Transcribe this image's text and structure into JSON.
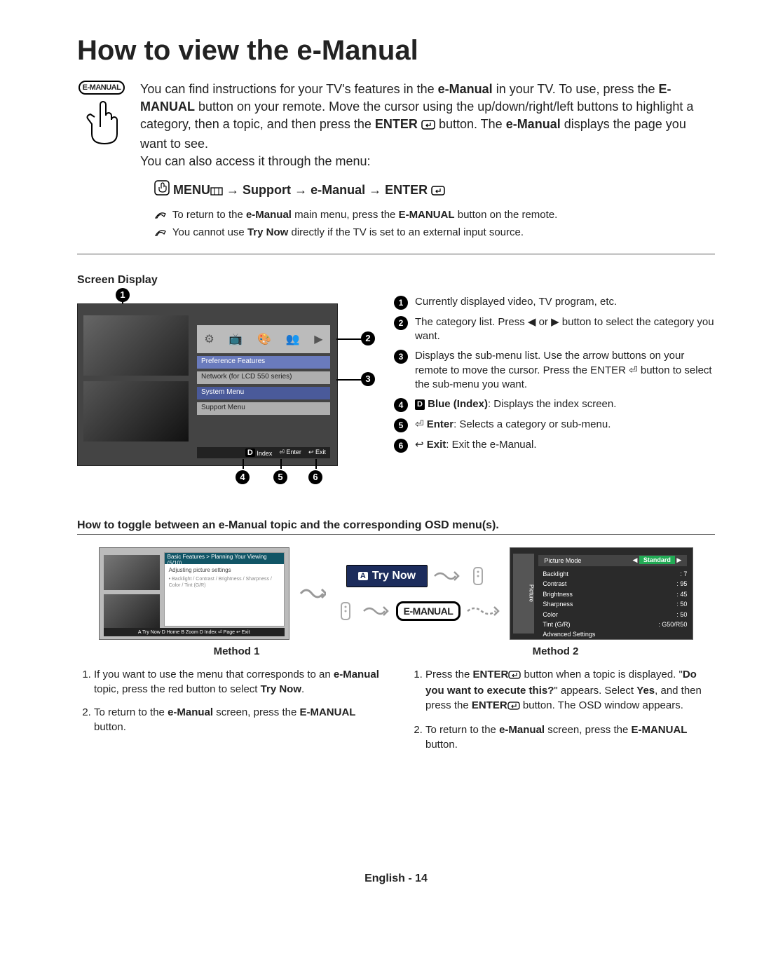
{
  "title": "How to view the e-Manual",
  "emanual_icon_label": "E-MANUAL",
  "intro": {
    "p1a": "You can find instructions for your TV's features in the ",
    "p1b": "e-Manual",
    "p1c": " in your TV. To use, press the ",
    "p1d": "E-MANUAL",
    "p1e": " button on your remote. Move the cursor using the up/down/right/left buttons to highlight a category, then a topic, and then press the ",
    "p1f": "ENTER",
    "p1g": " button. The ",
    "p1h": "e-Manual",
    "p1i": " displays the page you want to see.",
    "p2": "You can also access it through the menu:"
  },
  "menu_path": {
    "menu": "MENU",
    "support": "Support",
    "emanual": "e-Manual",
    "enter": "ENTER",
    "arrow": "→"
  },
  "notes": {
    "n1a": "To return to the ",
    "n1b": "e-Manual",
    "n1c": " main menu, press the ",
    "n1d": "E-MANUAL",
    "n1e": " button on the remote.",
    "n2a": "You cannot use ",
    "n2b": "Try Now",
    "n2c": " directly if the TV is set to an external input source."
  },
  "screen_display_heading": "Screen Display",
  "tv_mock": {
    "preference": "Preference Features",
    "network": "Network (for LCD 550 series)",
    "system": "System Menu",
    "support": "Support Menu",
    "footer_index": "Index",
    "footer_enter": "Enter",
    "footer_exit": "Exit",
    "footer_d": "D",
    "cat_arrow": "▶"
  },
  "legend": [
    {
      "num": "1",
      "text": "Currently displayed video, TV program, etc."
    },
    {
      "num": "2",
      "text": "The category list. Press ◀ or ▶ button to select the category you want."
    },
    {
      "num": "3",
      "text": "Displays the sub-menu list. Use the arrow buttons on your remote to move the cursor. Press the ENTER ⏎ button to select the sub-menu you want."
    },
    {
      "num": "4",
      "text_pre": "",
      "badge": "D",
      "bold": " Blue (Index)",
      "rest": ": Displays the index screen."
    },
    {
      "num": "5",
      "text_pre": "⏎ ",
      "bold": "Enter",
      "rest": ": Selects a category or sub-menu."
    },
    {
      "num": "6",
      "text_pre": "↩ ",
      "bold": "Exit",
      "rest": ": Exit the e-Manual."
    }
  ],
  "toggle_heading": "How to toggle between an e-Manual topic and the corresponding OSD menu(s).",
  "mid": {
    "try_now": "Try Now",
    "try_now_badge": "A",
    "emanual": "E-MANUAL"
  },
  "method1_mock": {
    "head": "Basic Features > Planning Your Viewing (5/10)",
    "sub": "Adjusting picture settings",
    "footer": "A Try Now  D Home  B Zoom  D Index  ⏎ Page  ↩ Exit"
  },
  "method2_mock": {
    "side": "Picture",
    "mode_label": "Picture Mode",
    "mode_value": "Standard",
    "rows": [
      {
        "k": "Backlight",
        "v": ": 7"
      },
      {
        "k": "Contrast",
        "v": ": 95"
      },
      {
        "k": "Brightness",
        "v": ": 45"
      },
      {
        "k": "Sharpness",
        "v": ": 50"
      },
      {
        "k": "Color",
        "v": ": 50"
      },
      {
        "k": "Tint (G/R)",
        "v": ": G50/R50"
      },
      {
        "k": "Advanced Settings",
        "v": ""
      }
    ]
  },
  "method_labels": {
    "m1": "Method 1",
    "m2": "Method 2"
  },
  "method1": {
    "i1a": "If you want to use the menu that corresponds to an ",
    "i1b": "e-Manual",
    "i1c": " topic, press the red button to select ",
    "i1d": "Try Now",
    "i1e": ".",
    "i2a": "To return to the ",
    "i2b": "e-Manual",
    "i2c": " screen, press the ",
    "i2d": "E-MANUAL",
    "i2e": " button."
  },
  "method2": {
    "i1a": "Press the ",
    "i1b": "ENTER",
    "i1c": " button when a topic is displayed. \"",
    "i1d": "Do you want to execute this?",
    "i1e": "\" appears. Select ",
    "i1f": "Yes",
    "i1g": ", and then press the ",
    "i1h": "ENTER",
    "i1i": " button. The OSD window appears.",
    "i2a": "To return to the ",
    "i2b": "e-Manual",
    "i2c": " screen, press the ",
    "i2d": "E-MANUAL",
    "i2e": " button."
  },
  "page_number": "English - 14"
}
